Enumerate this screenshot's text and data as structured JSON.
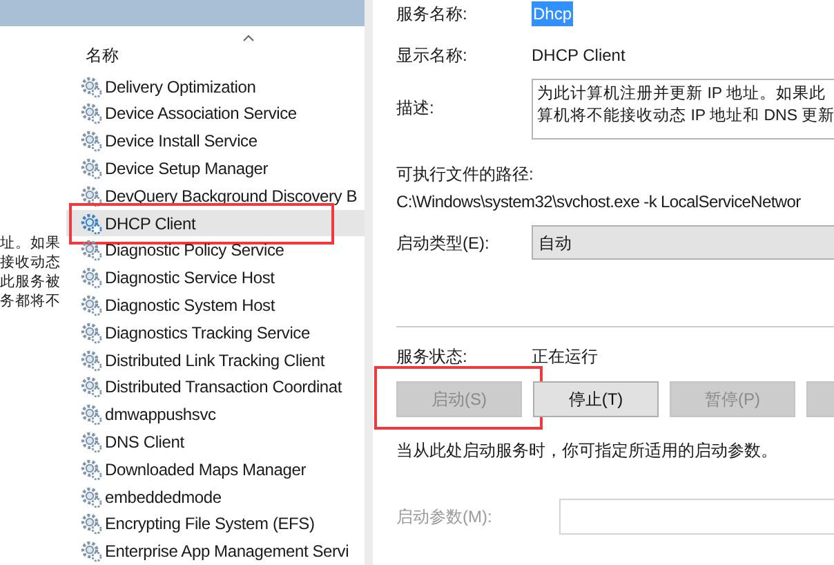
{
  "behind_text": [
    "址。如果",
    "接收动态",
    "此服务被",
    "务都将不"
  ],
  "services": {
    "header": "名称",
    "items": [
      {
        "name": "Delivery Optimization",
        "selected": false,
        "highlighted": false
      },
      {
        "name": "Device Association Service",
        "selected": false,
        "highlighted": false
      },
      {
        "name": "Device Install Service",
        "selected": false,
        "highlighted": false
      },
      {
        "name": "Device Setup Manager",
        "selected": false,
        "highlighted": false
      },
      {
        "name": "DevQuery Background Discovery B",
        "selected": false,
        "highlighted": false
      },
      {
        "name": "DHCP Client",
        "selected": true,
        "highlighted": true
      },
      {
        "name": "Diagnostic Policy Service",
        "selected": false,
        "highlighted": false
      },
      {
        "name": "Diagnostic Service Host",
        "selected": false,
        "highlighted": false
      },
      {
        "name": "Diagnostic System Host",
        "selected": false,
        "highlighted": false
      },
      {
        "name": "Diagnostics Tracking Service",
        "selected": false,
        "highlighted": false
      },
      {
        "name": "Distributed Link Tracking Client",
        "selected": false,
        "highlighted": false
      },
      {
        "name": "Distributed Transaction Coordinat",
        "selected": false,
        "highlighted": false
      },
      {
        "name": "dmwappushsvc",
        "selected": false,
        "highlighted": false
      },
      {
        "name": "DNS Client",
        "selected": false,
        "highlighted": false
      },
      {
        "name": "Downloaded Maps Manager",
        "selected": false,
        "highlighted": false
      },
      {
        "name": "embeddedmode",
        "selected": false,
        "highlighted": false
      },
      {
        "name": "Encrypting File System (EFS)",
        "selected": false,
        "highlighted": false
      },
      {
        "name": "Enterprise App Management Servi",
        "selected": false,
        "highlighted": false
      }
    ]
  },
  "properties": {
    "service_name": {
      "label": "服务名称:",
      "value": "Dhcp",
      "selected": true
    },
    "display_name": {
      "label": "显示名称:",
      "value": "DHCP Client"
    },
    "description": {
      "label": "描述:",
      "lines": [
        "为此计算机注册并更新 IP 地址。如果此",
        "算机将不能接收动态 IP 地址和 DNS 更新"
      ]
    },
    "path": {
      "label": "可执行文件的路径:",
      "value": "C:\\Windows\\system32\\svchost.exe -k LocalServiceNetwor"
    },
    "startup_type": {
      "label": "启动类型(E):",
      "value": "自动"
    },
    "status": {
      "label": "服务状态:",
      "value": "正在运行"
    },
    "buttons": [
      {
        "label": "启动(S)",
        "disabled": true,
        "highlighted": true
      },
      {
        "label": "停止(T)",
        "disabled": false,
        "highlighted": false
      },
      {
        "label": "暂停(P)",
        "disabled": true,
        "highlighted": false
      },
      {
        "disabled": true,
        "highlighted": false
      }
    ],
    "note": "当从此处启动服务时，你可指定所适用的启动参数。",
    "start_params": {
      "label": "启动参数(M):",
      "disabled": true
    }
  }
}
